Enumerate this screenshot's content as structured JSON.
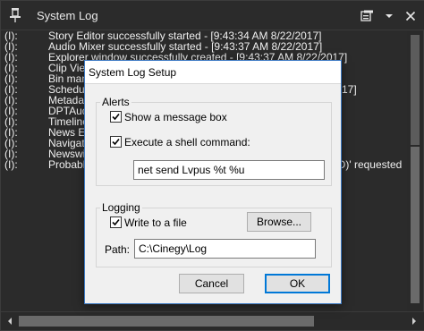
{
  "window": {
    "title": "System Log"
  },
  "log": {
    "lines": [
      {
        "prefix": "(I):",
        "message": "Story Editor successfully started - [9:43:34 AM 8/22/2017]"
      },
      {
        "prefix": "(I):",
        "message": "Audio Mixer successfully started - [9:43:37 AM 8/22/2017]"
      },
      {
        "prefix": "(I):",
        "message": "Explorer window successfully created - [9:43:37 AM 8/22/2017]"
      },
      {
        "prefix": "(I):",
        "message": "Clip View"
      },
      {
        "prefix": "(I):",
        "message": "Bin mana"
      },
      {
        "prefix": "(I):",
        "message": "Schedule",
        "tail": "17]"
      },
      {
        "prefix": "(I):",
        "message": "Metadat"
      },
      {
        "prefix": "(I):",
        "message": "DPTAud"
      },
      {
        "prefix": "(I):",
        "message": "Timeline"
      },
      {
        "prefix": "(I):",
        "message": "News Ed"
      },
      {
        "prefix": "(I):",
        "message": "Navigato"
      },
      {
        "prefix": "(I):",
        "message": "Newswin"
      },
      {
        "prefix": "(I):",
        "message": "Probably",
        "tail": "DD)' requested"
      }
    ]
  },
  "dialog": {
    "title": "System Log Setup",
    "alerts": {
      "label": "Alerts",
      "show_message_box": {
        "label": "Show a message box",
        "checked": true
      },
      "execute_shell": {
        "label": "Execute a shell command:",
        "checked": true
      },
      "command_value": "net send Lvpus %t %u"
    },
    "logging": {
      "label": "Logging",
      "write_to_file": {
        "label": "Write to a file",
        "checked": true
      },
      "browse_label": "Browse...",
      "path_label": "Path:",
      "path_value": "C:\\Cinegy\\Log"
    },
    "cancel_label": "Cancel",
    "ok_label": "OK"
  }
}
